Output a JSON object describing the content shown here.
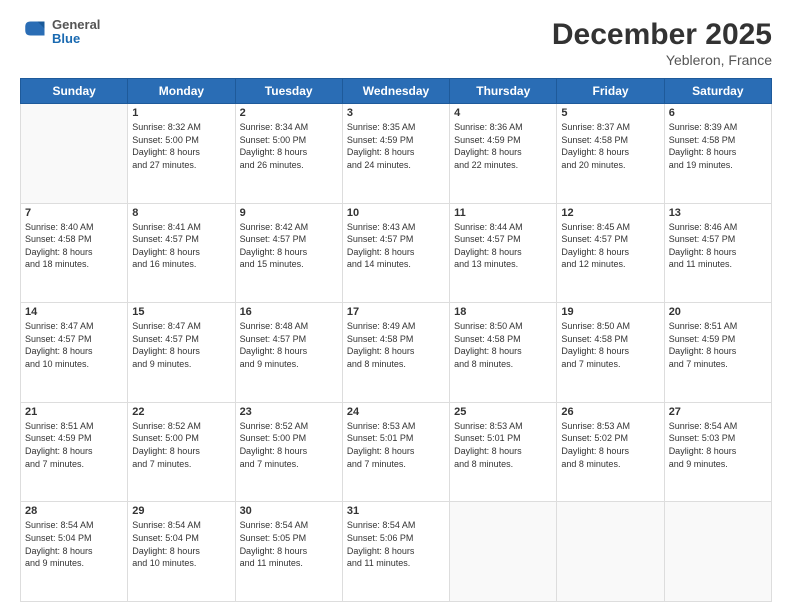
{
  "header": {
    "logo": {
      "general": "General",
      "blue": "Blue"
    },
    "title": "December 2025",
    "location": "Yebleron, France"
  },
  "weekdays": [
    "Sunday",
    "Monday",
    "Tuesday",
    "Wednesday",
    "Thursday",
    "Friday",
    "Saturday"
  ],
  "weeks": [
    [
      {
        "day": "",
        "info": ""
      },
      {
        "day": "1",
        "info": "Sunrise: 8:32 AM\nSunset: 5:00 PM\nDaylight: 8 hours\nand 27 minutes."
      },
      {
        "day": "2",
        "info": "Sunrise: 8:34 AM\nSunset: 5:00 PM\nDaylight: 8 hours\nand 26 minutes."
      },
      {
        "day": "3",
        "info": "Sunrise: 8:35 AM\nSunset: 4:59 PM\nDaylight: 8 hours\nand 24 minutes."
      },
      {
        "day": "4",
        "info": "Sunrise: 8:36 AM\nSunset: 4:59 PM\nDaylight: 8 hours\nand 22 minutes."
      },
      {
        "day": "5",
        "info": "Sunrise: 8:37 AM\nSunset: 4:58 PM\nDaylight: 8 hours\nand 20 minutes."
      },
      {
        "day": "6",
        "info": "Sunrise: 8:39 AM\nSunset: 4:58 PM\nDaylight: 8 hours\nand 19 minutes."
      }
    ],
    [
      {
        "day": "7",
        "info": "Sunrise: 8:40 AM\nSunset: 4:58 PM\nDaylight: 8 hours\nand 18 minutes."
      },
      {
        "day": "8",
        "info": "Sunrise: 8:41 AM\nSunset: 4:57 PM\nDaylight: 8 hours\nand 16 minutes."
      },
      {
        "day": "9",
        "info": "Sunrise: 8:42 AM\nSunset: 4:57 PM\nDaylight: 8 hours\nand 15 minutes."
      },
      {
        "day": "10",
        "info": "Sunrise: 8:43 AM\nSunset: 4:57 PM\nDaylight: 8 hours\nand 14 minutes."
      },
      {
        "day": "11",
        "info": "Sunrise: 8:44 AM\nSunset: 4:57 PM\nDaylight: 8 hours\nand 13 minutes."
      },
      {
        "day": "12",
        "info": "Sunrise: 8:45 AM\nSunset: 4:57 PM\nDaylight: 8 hours\nand 12 minutes."
      },
      {
        "day": "13",
        "info": "Sunrise: 8:46 AM\nSunset: 4:57 PM\nDaylight: 8 hours\nand 11 minutes."
      }
    ],
    [
      {
        "day": "14",
        "info": "Sunrise: 8:47 AM\nSunset: 4:57 PM\nDaylight: 8 hours\nand 10 minutes."
      },
      {
        "day": "15",
        "info": "Sunrise: 8:47 AM\nSunset: 4:57 PM\nDaylight: 8 hours\nand 9 minutes."
      },
      {
        "day": "16",
        "info": "Sunrise: 8:48 AM\nSunset: 4:57 PM\nDaylight: 8 hours\nand 9 minutes."
      },
      {
        "day": "17",
        "info": "Sunrise: 8:49 AM\nSunset: 4:58 PM\nDaylight: 8 hours\nand 8 minutes."
      },
      {
        "day": "18",
        "info": "Sunrise: 8:50 AM\nSunset: 4:58 PM\nDaylight: 8 hours\nand 8 minutes."
      },
      {
        "day": "19",
        "info": "Sunrise: 8:50 AM\nSunset: 4:58 PM\nDaylight: 8 hours\nand 7 minutes."
      },
      {
        "day": "20",
        "info": "Sunrise: 8:51 AM\nSunset: 4:59 PM\nDaylight: 8 hours\nand 7 minutes."
      }
    ],
    [
      {
        "day": "21",
        "info": "Sunrise: 8:51 AM\nSunset: 4:59 PM\nDaylight: 8 hours\nand 7 minutes."
      },
      {
        "day": "22",
        "info": "Sunrise: 8:52 AM\nSunset: 5:00 PM\nDaylight: 8 hours\nand 7 minutes."
      },
      {
        "day": "23",
        "info": "Sunrise: 8:52 AM\nSunset: 5:00 PM\nDaylight: 8 hours\nand 7 minutes."
      },
      {
        "day": "24",
        "info": "Sunrise: 8:53 AM\nSunset: 5:01 PM\nDaylight: 8 hours\nand 7 minutes."
      },
      {
        "day": "25",
        "info": "Sunrise: 8:53 AM\nSunset: 5:01 PM\nDaylight: 8 hours\nand 8 minutes."
      },
      {
        "day": "26",
        "info": "Sunrise: 8:53 AM\nSunset: 5:02 PM\nDaylight: 8 hours\nand 8 minutes."
      },
      {
        "day": "27",
        "info": "Sunrise: 8:54 AM\nSunset: 5:03 PM\nDaylight: 8 hours\nand 9 minutes."
      }
    ],
    [
      {
        "day": "28",
        "info": "Sunrise: 8:54 AM\nSunset: 5:04 PM\nDaylight: 8 hours\nand 9 minutes."
      },
      {
        "day": "29",
        "info": "Sunrise: 8:54 AM\nSunset: 5:04 PM\nDaylight: 8 hours\nand 10 minutes."
      },
      {
        "day": "30",
        "info": "Sunrise: 8:54 AM\nSunset: 5:05 PM\nDaylight: 8 hours\nand 11 minutes."
      },
      {
        "day": "31",
        "info": "Sunrise: 8:54 AM\nSunset: 5:06 PM\nDaylight: 8 hours\nand 11 minutes."
      },
      {
        "day": "",
        "info": ""
      },
      {
        "day": "",
        "info": ""
      },
      {
        "day": "",
        "info": ""
      }
    ]
  ]
}
